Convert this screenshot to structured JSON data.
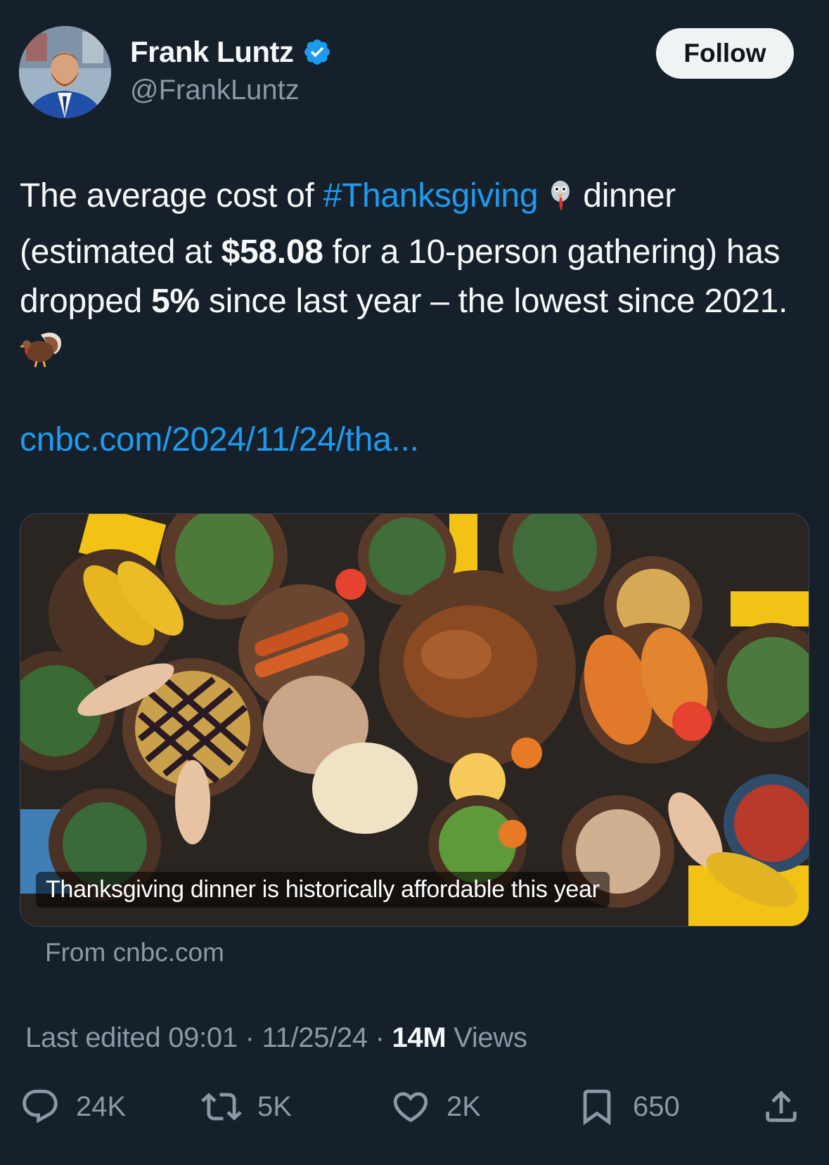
{
  "author": {
    "display_name": "Frank Luntz",
    "handle": "@FrankLuntz",
    "follow_label": "Follow"
  },
  "tweet": {
    "text_1": "The average cost of ",
    "hashtag": "#Thanksgiving",
    "text_2": " dinner (estimated at ",
    "price": "$58.08",
    "text_3": " for a 10-person gathering) has dropped ",
    "percent": "5%",
    "text_4": " since last year – the lowest since 2021. ",
    "link": "cnbc.com/2024/11/24/tha..."
  },
  "card": {
    "caption": "Thanksgiving dinner is historically affordable this year",
    "source": "From cnbc.com"
  },
  "meta": {
    "edited": "Last edited 09:01 · 11/25/24",
    "separator": " · ",
    "views_count": "14M",
    "views_label": " Views"
  },
  "actions": {
    "replies": "24K",
    "reposts": "5K",
    "likes": "2K",
    "bookmarks": "650"
  },
  "colors": {
    "background": "#15202b",
    "accent": "#1d9bf0",
    "secondary_text": "#8b98a5"
  }
}
